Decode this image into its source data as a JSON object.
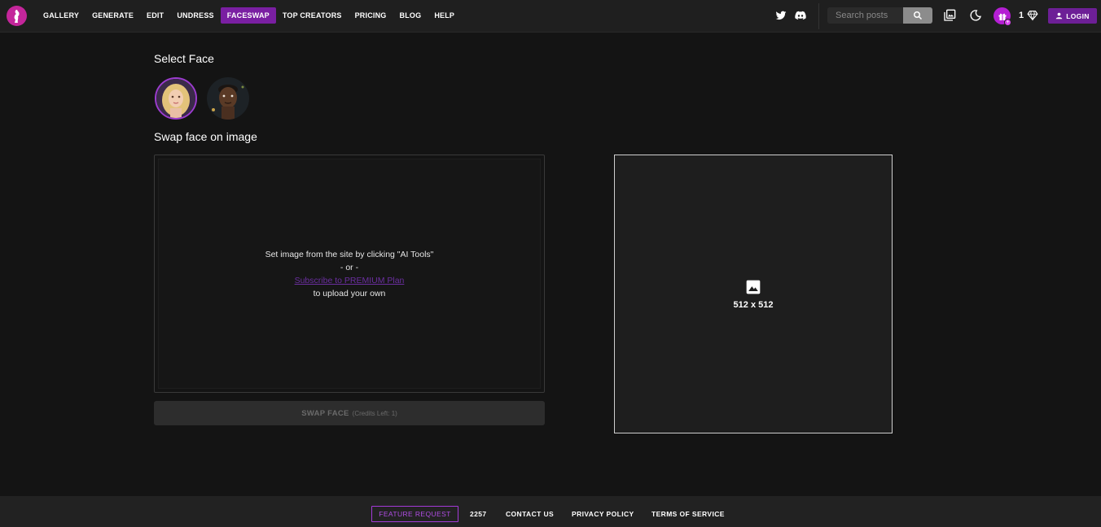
{
  "header": {
    "nav": [
      {
        "label": "GALLERY",
        "active": false
      },
      {
        "label": "GENERATE",
        "active": false
      },
      {
        "label": "EDIT",
        "active": false
      },
      {
        "label": "UNDRESS",
        "active": false
      },
      {
        "label": "FACESWAP",
        "active": true
      },
      {
        "label": "TOP CREATORS",
        "active": false
      },
      {
        "label": "PRICING",
        "active": false
      },
      {
        "label": "BLOG",
        "active": false
      },
      {
        "label": "HELP",
        "active": false
      }
    ],
    "search_placeholder": "Search posts",
    "credits": "1",
    "login_label": "LOGIN",
    "accent": "#7a1fa2"
  },
  "main": {
    "select_face_title": "Select Face",
    "swap_title": "Swap face on image",
    "upload": {
      "line1": "Set image from the site by clicking \"AI Tools\"",
      "line2": "- or -",
      "link": "Subscribe to PREMIUM Plan",
      "line3": "to upload your own"
    },
    "swap_button": {
      "label": "SWAP FACE",
      "sub": "(Credits Left: 1)"
    },
    "result_dim": "512 x 512"
  },
  "footer": {
    "feature_request": "FEATURE REQUEST",
    "count": "2257",
    "contact": "CONTACT US",
    "privacy": "PRIVACY POLICY",
    "terms": "TERMS OF SERVICE"
  }
}
